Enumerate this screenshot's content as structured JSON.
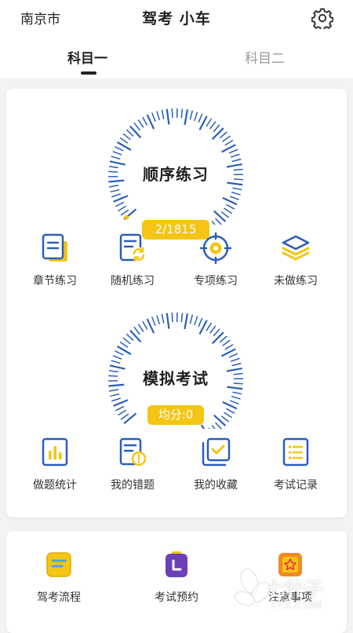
{
  "header": {
    "city": "南京市",
    "title": "驾考 小车",
    "settings_icon": "gear-icon"
  },
  "tabs": [
    {
      "label": "科目一",
      "active": true
    },
    {
      "label": "科目二",
      "active": false
    }
  ],
  "practice": {
    "dial_label": "顺序练习",
    "progress_text": "2/1815",
    "progress_value": 2,
    "progress_total": 1815,
    "items": [
      {
        "label": "章节练习",
        "icon": "document-icon"
      },
      {
        "label": "随机练习",
        "icon": "shuffle-doc-icon"
      },
      {
        "label": "专项练习",
        "icon": "target-icon"
      },
      {
        "label": "未做练习",
        "icon": "layers-icon"
      }
    ]
  },
  "exam": {
    "dial_label": "模拟考试",
    "score_text": "均分:0",
    "items": [
      {
        "label": "做题统计",
        "icon": "bar-chart-icon"
      },
      {
        "label": "我的错题",
        "icon": "error-doc-icon"
      },
      {
        "label": "我的收藏",
        "icon": "favorite-check-icon"
      },
      {
        "label": "考试记录",
        "icon": "list-icon"
      }
    ]
  },
  "bottom": {
    "items": [
      {
        "label": "驾考流程",
        "icon": "flow-doc-icon"
      },
      {
        "label": "考试预约",
        "icon": "calendar-icon"
      },
      {
        "label": "注意事项",
        "icon": "star-doc-icon"
      }
    ]
  },
  "watermark": {
    "text": "七叶子",
    "sub": "7YZ.COM"
  },
  "colors": {
    "accent_blue": "#2b5fb8",
    "accent_yellow": "#f5c514",
    "tab_active": "#222222",
    "tab_inactive": "#9a9a9a"
  }
}
